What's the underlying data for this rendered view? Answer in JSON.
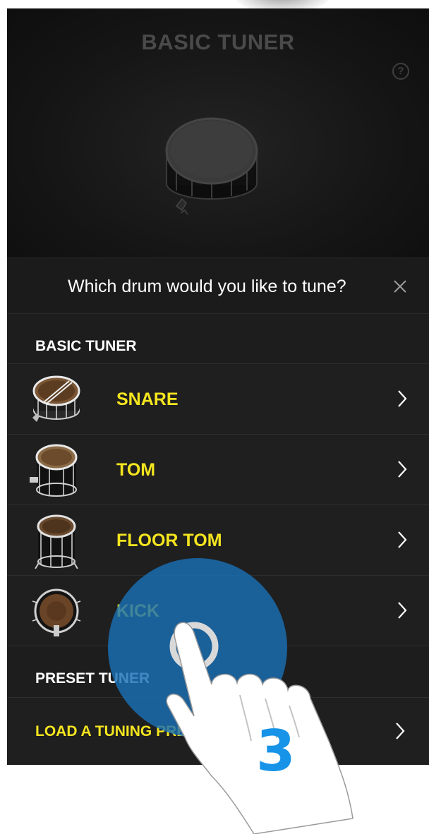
{
  "hero": {
    "title": "BASIC TUNER",
    "help_icon": "help-circle-icon",
    "image": "snare-drum-image"
  },
  "prompt": {
    "text": "Which drum would you like to tune?",
    "close_icon": "close-icon"
  },
  "basic_section": {
    "title": "BASIC TUNER",
    "items": [
      {
        "label": "SNARE",
        "icon": "snare-drum-icon",
        "chevron": "chevron-right-icon"
      },
      {
        "label": "TOM",
        "icon": "tom-drum-icon",
        "chevron": "chevron-right-icon"
      },
      {
        "label": "FLOOR TOM",
        "icon": "floor-tom-drum-icon",
        "chevron": "chevron-right-icon"
      },
      {
        "label": "KICK",
        "icon": "kick-drum-icon",
        "chevron": "chevron-right-icon"
      }
    ]
  },
  "preset_section": {
    "title": "PRESET TUNER",
    "item": {
      "label": "LOAD A TUNING PRESET FROM LIST",
      "chevron": "chevron-right-icon"
    }
  },
  "overlay": {
    "step_number": "3",
    "icon": "tap-gesture-hand-icon"
  },
  "colors": {
    "background": "#1f1f1f",
    "accent_yellow": "#f4e51f",
    "touch_circle": "#1a6fb5",
    "step_number": "#1793e8"
  }
}
